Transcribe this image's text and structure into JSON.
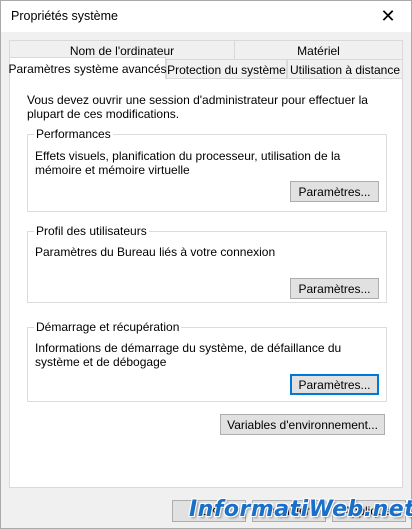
{
  "window": {
    "title": "Propriétés système",
    "close_glyph": "✕"
  },
  "tabs": {
    "row1": [
      {
        "label": "Nom de l'ordinateur"
      },
      {
        "label": "Matériel"
      }
    ],
    "row2": [
      {
        "label": "Paramètres système avancés",
        "active": true
      },
      {
        "label": "Protection du système"
      },
      {
        "label": "Utilisation à distance"
      }
    ]
  },
  "panel": {
    "intro": "Vous devez ouvrir une session d'administrateur pour effectuer la plupart de ces modifications.",
    "performances": {
      "legend": "Performances",
      "description": "Effets visuels, planification du processeur, utilisation de la mémoire et mémoire virtuelle",
      "button": "Paramètres..."
    },
    "profils": {
      "legend": "Profil des utilisateurs",
      "description": "Paramètres du Bureau liés à votre connexion",
      "button": "Paramètres..."
    },
    "demarrage": {
      "legend": "Démarrage et récupération",
      "description": "Informations de démarrage du système, de défaillance du système et de débogage",
      "button": "Paramètres..."
    },
    "env_button": "Variables d'environnement..."
  },
  "footer": {
    "ok": "OK",
    "cancel": "Annuler",
    "apply": "Appliquer"
  },
  "watermark": {
    "text": "InformatiWeb.net"
  },
  "colors": {
    "focus_border": "#0078d7",
    "watermark": "#1a6fc9"
  }
}
